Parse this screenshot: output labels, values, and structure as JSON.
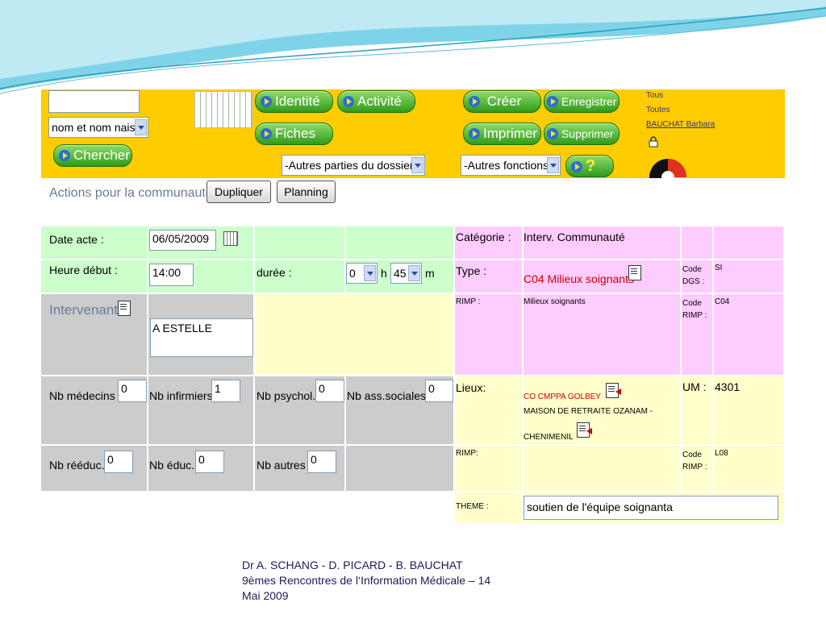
{
  "toolbar": {
    "search_value": "",
    "search_type": "nom et nom nais.",
    "search_button": "Chercher",
    "nav_buttons": [
      "Identité",
      "Activité",
      "Fiches"
    ],
    "dossier_select": "-Autres parties du dossier-",
    "action_buttons": [
      "Créer",
      "Enregistrer",
      "Imprimer",
      "Supprimer"
    ],
    "fonctions_select": "-Autres fonctions-",
    "help_button": "?",
    "links": [
      "Tous",
      "Toutes",
      "BAUCHAT  Barbara"
    ]
  },
  "actions": {
    "title": "Actions pour la communauté",
    "duplicate": "Dupliquer",
    "planning": "Planning"
  },
  "form": {
    "date_label": "Date acte :",
    "date_value": "06/05/2009",
    "heure_label": "Heure début :",
    "heure_value": "14:00",
    "duree_label": "durée :",
    "duree_h": "0",
    "h_label": "h",
    "duree_m": "45",
    "m_label": "m",
    "intervenants_label": "Intervenants",
    "intervenant_value": "A        ESTELLE",
    "nb_medecins_label": "Nb médecins",
    "nb_medecins": "0",
    "nb_infirmiers_label": "Nb infirmiers",
    "nb_infirmiers": "1",
    "nb_psychol_label": "Nb psychol.",
    "nb_psychol": "0",
    "nb_ass_label": "Nb ass.sociales",
    "nb_ass": "0",
    "nb_reeduc_label": "Nb rééduc.",
    "nb_reeduc": "0",
    "nb_educ_label": "Nb éduc.",
    "nb_educ": "0",
    "nb_autres_label": "Nb autres",
    "nb_autres": "0"
  },
  "details": {
    "categorie_label": "Catégorie :",
    "categorie_value": "Interv. Communauté",
    "type_label": "Type :",
    "type_value": "C04 Milieux soignants",
    "code_dgs_label": "Code DGS :",
    "code_dgs_value": "SI",
    "rimp_label": "RIMP :",
    "rimp_value": "Milieux soignants",
    "code_rimp_label": "Code RIMP :",
    "code_rimp_value": "C04",
    "lieux_label": "Lieux:",
    "lieux_value1": "CO CMPPA GOLBEY",
    "lieux_value2": "MAISON DE RETRAITE OZANAM -",
    "lieux_value3": "CHENIMENIL",
    "um_label": "UM :",
    "um_value": "4301",
    "rimp2_label": "RIMP:",
    "code_rimp2_label": "Code RIMP :",
    "code_rimp2_value": "L08",
    "theme_label": "THEME :",
    "theme_value": "soutien de l'équipe soignanta"
  },
  "footer": {
    "line1": "Dr A. SCHANG - D. PICARD - B. BAUCHAT",
    "line2": "9èmes Rencontres de l‘Information Médicale – 14",
    "line3": "Mai 2009"
  }
}
